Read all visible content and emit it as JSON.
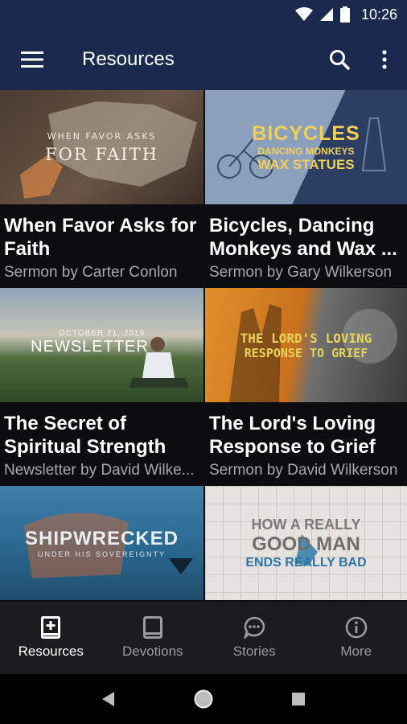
{
  "status_bar": {
    "time": "10:26"
  },
  "app_bar": {
    "title": "Resources"
  },
  "cards": [
    {
      "thumb_line1": "WHEN FAVOR ASKS",
      "thumb_line2": "FOR FAITH",
      "title_line1": "When Favor Asks for",
      "title_line2": "Faith",
      "subtitle": "Sermon by Carter Conlon"
    },
    {
      "thumb_line1": "BICYCLES",
      "thumb_line2": "DANCING MONKEYS",
      "thumb_line3": "WAX STATUES",
      "title_line1": "Bicycles, Dancing",
      "title_line2": "Monkeys and Wax ...",
      "subtitle": "Sermon by Gary Wilkerson"
    },
    {
      "thumb_line1": "OCTOBER 21, 2019",
      "thumb_line2": "NEWSLETTER",
      "title_line1": "The Secret of",
      "title_line2": "Spiritual Strength",
      "subtitle": "Newsletter by David Wilke..."
    },
    {
      "thumb_line1": "THE LORD'S LOVING",
      "thumb_line2": "RESPONSE TO GRIEF",
      "title_line1": "The Lord's Loving",
      "title_line2": "Response to Grief",
      "subtitle": "Sermon by David Wilkerson"
    },
    {
      "thumb_line1": "SHIPWRECKED",
      "thumb_line2": "UNDER HIS SOVEREIGNTY"
    },
    {
      "thumb_line1": "HOW A REALLY",
      "thumb_line2": "GOOD MAN",
      "thumb_line3": "ENDS REALLY BAD"
    }
  ],
  "bottom_nav": [
    {
      "label": "Resources",
      "icon": "book-plus-icon",
      "active": true
    },
    {
      "label": "Devotions",
      "icon": "book-icon",
      "active": false
    },
    {
      "label": "Stories",
      "icon": "chat-bubble-icon",
      "active": false
    },
    {
      "label": "More",
      "icon": "info-icon",
      "active": false
    }
  ],
  "colors": {
    "app_bar": "#1a2a4e",
    "background": "#0d0d10",
    "bottom_nav": "#1c1c1f"
  }
}
